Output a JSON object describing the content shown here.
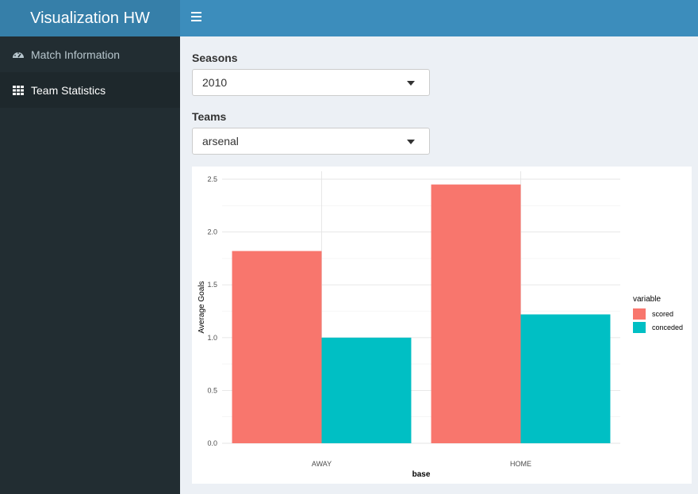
{
  "header": {
    "title": "Visualization HW"
  },
  "sidebar": {
    "items": [
      {
        "label": "Match Information",
        "icon": "dashboard-icon",
        "active": false
      },
      {
        "label": "Team Statistics",
        "icon": "grid-icon",
        "active": true
      }
    ]
  },
  "inputs": {
    "seasons": {
      "label": "Seasons",
      "value": "2010"
    },
    "teams": {
      "label": "Teams",
      "value": "arsenal"
    }
  },
  "colors": {
    "scored": "#f8766d",
    "conceded": "#00bfc4",
    "header": "#3c8dbc",
    "logo": "#367fa9",
    "sidebar": "#222d32"
  },
  "chart_data": {
    "type": "bar",
    "categories": [
      "AWAY",
      "HOME"
    ],
    "series": [
      {
        "name": "scored",
        "values": [
          1.82,
          2.45
        ]
      },
      {
        "name": "conceded",
        "values": [
          1.0,
          1.22
        ]
      }
    ],
    "xlabel": "base",
    "ylabel": "Average Goals",
    "ylim": [
      0,
      2.5
    ],
    "yticks": [
      "0.0",
      "0.5",
      "1.0",
      "1.5",
      "2.0",
      "2.5"
    ],
    "legend_title": "variable",
    "legend_position": "right",
    "grid": true
  }
}
